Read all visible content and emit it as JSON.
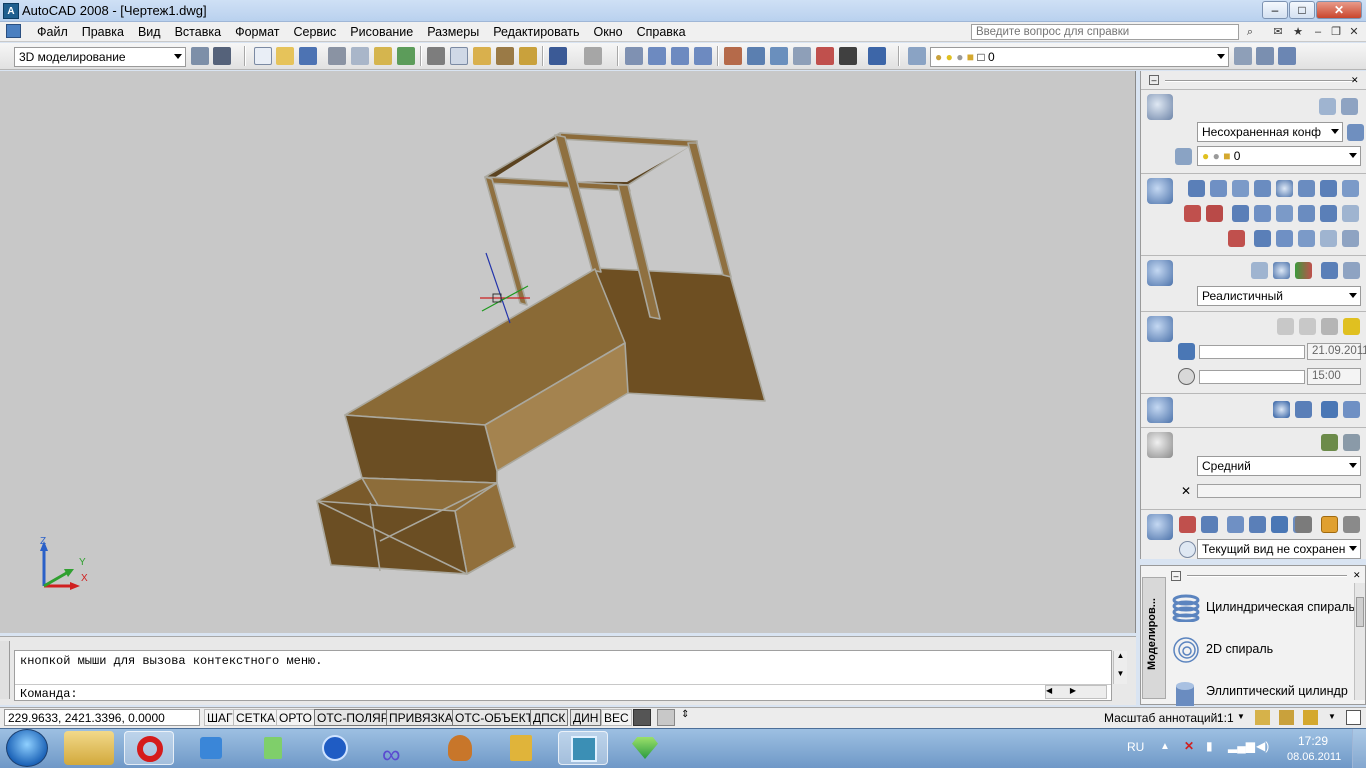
{
  "window": {
    "title": "AutoCAD 2008 - [Чертеж1.dwg]",
    "app_icon_label": "A"
  },
  "menu": {
    "items": [
      "Файл",
      "Правка",
      "Вид",
      "Вставка",
      "Формат",
      "Сервис",
      "Рисование",
      "Размеры",
      "Редактировать",
      "Окно",
      "Справка"
    ],
    "help_placeholder": "Введите вопрос для справки"
  },
  "toolbar": {
    "workspace": "3D моделирование",
    "layer_value": "0"
  },
  "palette": {
    "layer_state": "Несохраненная конф",
    "layer_value": "0",
    "visual_style": "Реалистичный",
    "date": "21.09.2011",
    "time": "15:00",
    "render_quality": "Средний",
    "view": "Текущий вид не сохранен"
  },
  "tool_palette": {
    "tab_label": "Моделиров...",
    "items": [
      "Цилиндрическая спираль",
      "2D спираль",
      "Эллиптический цилиндр"
    ]
  },
  "command": {
    "line1": "кнопкой мыши для вызова контекстного меню.",
    "prompt": "Команда:"
  },
  "ucs": {
    "x": "X",
    "y": "Y",
    "z": "Z"
  },
  "status": {
    "coords": "229.9633,  2421.3396, 0.0000",
    "buttons": [
      "ШАГ",
      "СЕТКА",
      "ОРТО",
      "ОТС-ПОЛЯР",
      "ПРИВЯЗКА",
      "ОТС-ОБЪЕКТ",
      "ДПСК",
      "ДИН",
      "ВЕС"
    ],
    "annotation_scale_label": "Масштаб аннотаций:",
    "annotation_scale": "1:1"
  },
  "taskbar": {
    "lang": "RU",
    "time": "17:29",
    "date": "08.06.2011"
  },
  "colors": {
    "model_face_dark": "#6b4e23",
    "model_face_light": "#9b7844",
    "model_edge": "#a8a8a0",
    "viewport_bg": "#c8c8c8"
  }
}
